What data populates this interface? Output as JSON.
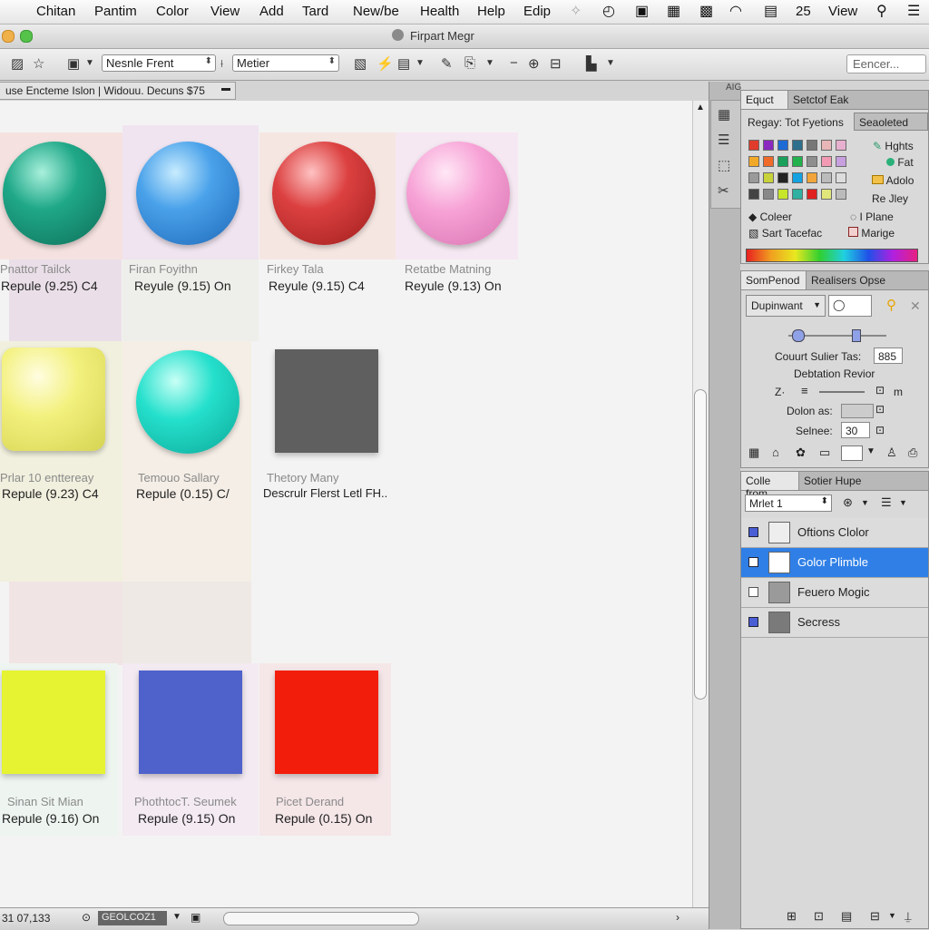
{
  "menu_bar": {
    "items": [
      "Chitan",
      "Pantim",
      "Color",
      "View",
      "Add",
      "Tard",
      "New/be",
      "Health",
      "Help",
      "Edip"
    ],
    "status_text": "25",
    "view_label": "View"
  },
  "window": {
    "title": "Firpart Megr"
  },
  "toolbar": {
    "font_select": "Nesnle Frent",
    "style_select": "Metier",
    "search_placeholder": "Eencer..."
  },
  "document": {
    "tab_title": "use Encteme Islon | Widouu. Decuns $75"
  },
  "swatches": [
    {
      "name": "Pnattor Tailck",
      "value": "Repule (9.25) C4",
      "color": "#1fa888",
      "shape": "ball"
    },
    {
      "name": "Firan Foyithn",
      "value": "Reyule (9.15) On",
      "color": "#4aa2ea",
      "shape": "ball"
    },
    {
      "name": "Firkey Tala",
      "value": "Reyule (9.15) C4",
      "color": "#dc4040",
      "shape": "ball"
    },
    {
      "name": "Retatbe Matning",
      "value": "Reyule (9.13) On",
      "color": "#f7a2d6",
      "shape": "ball"
    },
    {
      "name": "Prlar 10 enttereay",
      "value": "Repule (9.23) C4",
      "color": "#f3f17e",
      "shape": "rounded"
    },
    {
      "name": "Temouo Sallary",
      "value": "Repule (0.15) C/",
      "color": "#24e0cc",
      "shape": "ball"
    },
    {
      "name": "Thetory Many",
      "value": "Descrulr Flerst Letl FH..",
      "color": "#5f5f5f",
      "shape": "square"
    },
    {
      "name": "Sinan Sit Mian",
      "value": "Repule (9.16) On",
      "color": "#e6f332",
      "shape": "square"
    },
    {
      "name": "PhothtocT. Seumek",
      "value": "Repule (9.15) On",
      "color": "#4f62cc",
      "shape": "square"
    },
    {
      "name": "Picet Derand",
      "value": "Repule (0.15) On",
      "color": "#f31d0c",
      "shape": "square"
    }
  ],
  "status_bar": {
    "coords": "31 07,133",
    "mode": "GEOLCOZ1"
  },
  "dock_label": "AIG",
  "swatches_panel": {
    "tabs": [
      "Equct",
      "Setctof Eak"
    ],
    "preset_label": "Regay: Tot Fyetions",
    "preset_button": "Seaoleted",
    "options": [
      "Hghts",
      "Fat",
      "Adolo",
      "Re Jley",
      "I Plane",
      "Marige"
    ],
    "color_label": "Coleer",
    "sort_label": "Sart Tacefac",
    "grid_colors": [
      "#e03b2b",
      "#8a28c0",
      "#1f6bd6",
      "#2e6f8c",
      "#777777",
      "#e8b6b6",
      "#e7b0cf",
      "#f3a928",
      "#f06a2a",
      "#1aa05a",
      "#22b14c",
      "#8e8e8e",
      "#f29ab3",
      "#c8a0e0",
      "#9a9a9a",
      "#c8d23a",
      "#222222",
      "#14a2e0",
      "#f2a53a",
      "#bbbbbb",
      "#dddddd",
      "#444444",
      "#888888",
      "#c7e62a",
      "#2fb0a0",
      "#e01f1f",
      "#e0e67a",
      "#bbbbbb"
    ]
  },
  "properties_panel": {
    "tabs": [
      "SomPenod",
      "Realisers Opse"
    ],
    "mode_select": "Dupinwant",
    "count_label": "Couurt Sulier Tas:",
    "count_value": "885",
    "rotation_label": "Debtation Revior",
    "z_label": "Z·",
    "m_label": "m",
    "dolon_label": "Dolon as:",
    "selnee_label": "Selnee:",
    "selnee_value": "30"
  },
  "layers_panel": {
    "tabs": [
      "Colle from",
      "Sotier Hupe"
    ],
    "blend_select": "Mrlet 1",
    "layers": [
      {
        "name": "Oftions Clolor",
        "visible": true,
        "selected": false
      },
      {
        "name": "Golor Plimble",
        "visible": true,
        "selected": true
      },
      {
        "name": "Feuero Mogic",
        "visible": false,
        "selected": false
      },
      {
        "name": "Secress",
        "visible": true,
        "selected": false
      }
    ]
  }
}
